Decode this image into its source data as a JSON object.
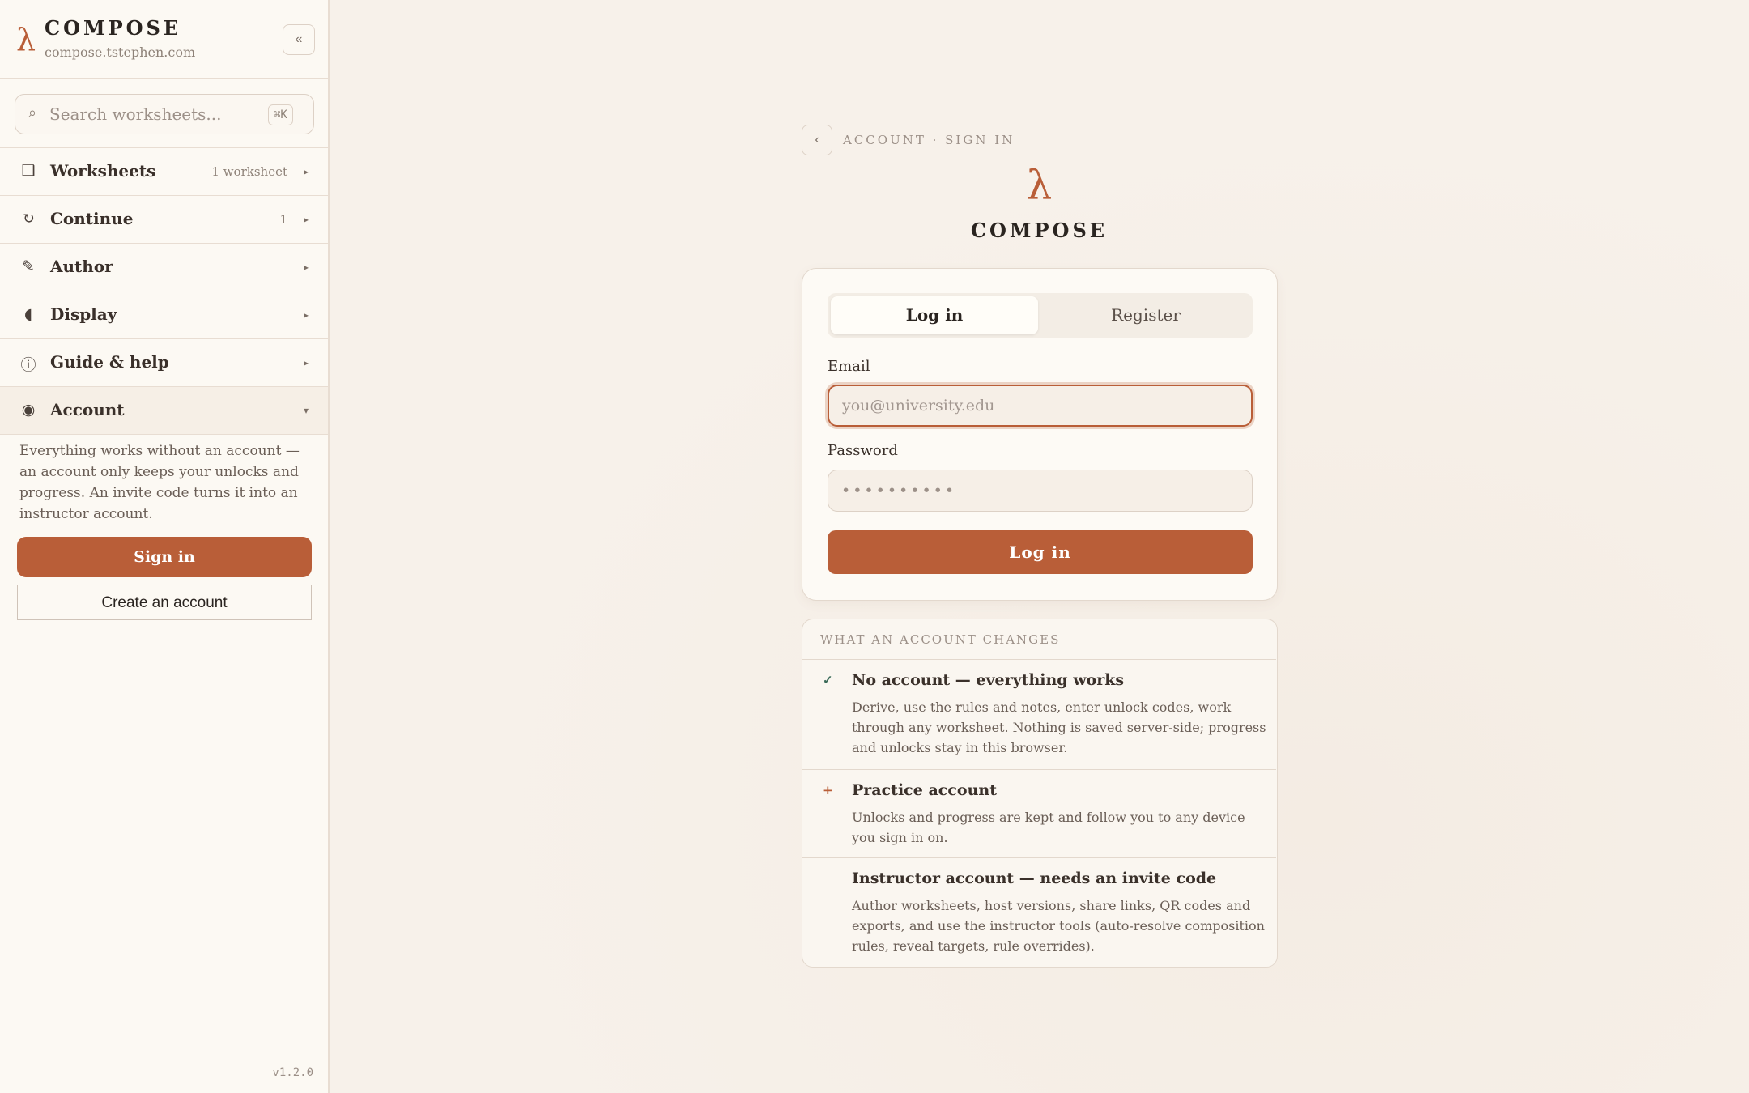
{
  "sidebar": {
    "brand": {
      "symbol": "λ",
      "name": "COMPOSE",
      "url": "compose.tstephen.com"
    },
    "collapse_label": "«",
    "search": {
      "placeholder": "Search worksheets...",
      "shortcut": "⌘K",
      "icon": "search-icon"
    },
    "nav": [
      {
        "label": "Worksheets",
        "meta": "1 worksheet",
        "icon": "square-icon",
        "glyph": "❑",
        "caret": "▸"
      },
      {
        "label": "Continue",
        "meta": "1",
        "icon": "refresh-icon",
        "glyph": "↻",
        "caret": "▸"
      },
      {
        "label": "Author",
        "meta": "",
        "icon": "pencil-icon",
        "glyph": "✎",
        "caret": "▸"
      },
      {
        "label": "Display",
        "meta": "",
        "icon": "half-circle-icon",
        "glyph": "◖",
        "caret": "▸"
      },
      {
        "label": "Guide & help",
        "meta": "",
        "icon": "info-icon",
        "glyph": "ⓘ",
        "caret": "▸"
      },
      {
        "label": "Account",
        "meta": "",
        "icon": "user-circle-icon",
        "glyph": "◉",
        "caret": "▾"
      }
    ],
    "account": {
      "text": "Everything works without an account — an account only keeps your unlocks and progress. An invite code turns it into an instructor account.",
      "sign_in": "Sign in",
      "create": "Create an account"
    },
    "version": "v1.2.0"
  },
  "main": {
    "back_label": "‹",
    "breadcrumb": "ACCOUNT · SIGN IN",
    "logo": {
      "symbol": "λ",
      "name": "COMPOSE"
    },
    "tabs": {
      "login": "Log in",
      "register": "Register"
    },
    "email": {
      "label": "Email",
      "placeholder": "you@university.edu",
      "value": ""
    },
    "password": {
      "label": "Password",
      "placeholder": "••••••••••",
      "value": ""
    },
    "submit": "Log in",
    "info": {
      "title": "WHAT AN ACCOUNT CHANGES",
      "items": [
        {
          "mark": "✓",
          "heading": "No account — everything works",
          "body": "Derive, use the rules and notes, enter unlock codes, work through any worksheet. Nothing is saved server-side; progress and unlocks stay in this browser."
        },
        {
          "mark": "+",
          "heading": "Practice account",
          "body": "Unlocks and progress are kept and follow you to any device you sign in on."
        },
        {
          "mark": "",
          "heading": "Instructor account — needs an invite code",
          "body": "Author worksheets, host versions, share links, QR codes and exports, and use the instructor tools (auto-resolve composition rules, reveal targets, rule overrides)."
        }
      ]
    }
  },
  "colors": {
    "accent": "#b95e38",
    "background": "#f7f1ea",
    "sidebar": "#fcf9f3",
    "text": "#2a2420",
    "muted": "#8e8278"
  }
}
